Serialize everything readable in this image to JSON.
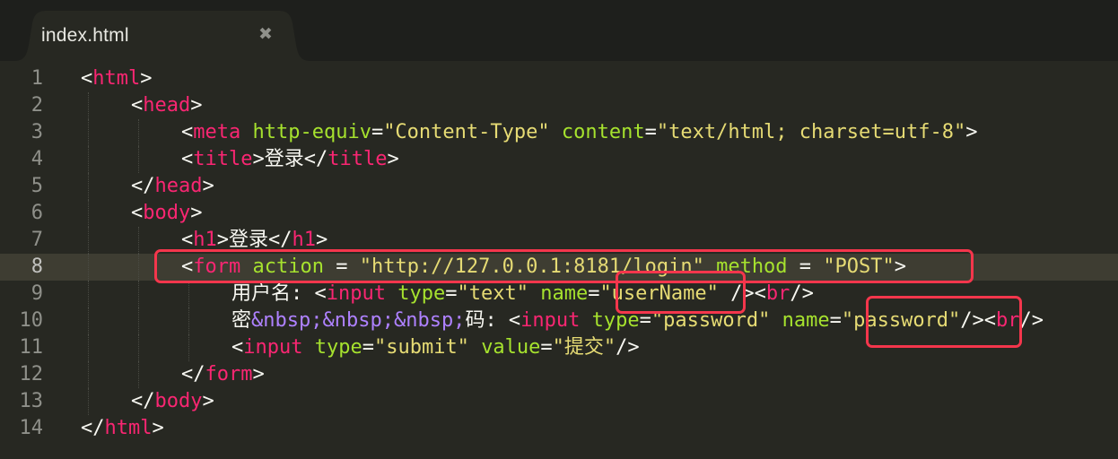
{
  "tab": {
    "title": "index.html",
    "close_glyph": "✖"
  },
  "editor": {
    "current_line": 8,
    "lines": [
      {
        "n": "1",
        "indent": 0,
        "tokens": [
          [
            "p",
            "<"
          ],
          [
            "t",
            "html"
          ],
          [
            "p",
            ">"
          ]
        ]
      },
      {
        "n": "2",
        "indent": 1,
        "tokens": [
          [
            "p",
            "<"
          ],
          [
            "t",
            "head"
          ],
          [
            "p",
            ">"
          ]
        ]
      },
      {
        "n": "3",
        "indent": 2,
        "tokens": [
          [
            "p",
            "<"
          ],
          [
            "t",
            "meta"
          ],
          [
            "p",
            " "
          ],
          [
            "a",
            "http-equiv"
          ],
          [
            "p",
            "="
          ],
          [
            "s",
            "\"Content-Type\""
          ],
          [
            "p",
            " "
          ],
          [
            "a",
            "content"
          ],
          [
            "p",
            "="
          ],
          [
            "s",
            "\"text/html; charset=utf-8\""
          ],
          [
            "p",
            ">"
          ]
        ]
      },
      {
        "n": "4",
        "indent": 2,
        "tokens": [
          [
            "p",
            "<"
          ],
          [
            "t",
            "title"
          ],
          [
            "p",
            ">登录</"
          ],
          [
            "t",
            "title"
          ],
          [
            "p",
            ">"
          ]
        ]
      },
      {
        "n": "5",
        "indent": 1,
        "tokens": [
          [
            "p",
            "</"
          ],
          [
            "t",
            "head"
          ],
          [
            "p",
            ">"
          ]
        ]
      },
      {
        "n": "6",
        "indent": 1,
        "tokens": [
          [
            "p",
            "<"
          ],
          [
            "t",
            "body"
          ],
          [
            "p",
            ">"
          ]
        ]
      },
      {
        "n": "7",
        "indent": 2,
        "tokens": [
          [
            "p",
            "<"
          ],
          [
            "t",
            "h1"
          ],
          [
            "p",
            ">登录</"
          ],
          [
            "t",
            "h1"
          ],
          [
            "p",
            ">"
          ]
        ]
      },
      {
        "n": "8",
        "indent": 2,
        "tokens": [
          [
            "p",
            "<"
          ],
          [
            "t",
            "form"
          ],
          [
            "p",
            " "
          ],
          [
            "a",
            "action"
          ],
          [
            "p",
            " = "
          ],
          [
            "s",
            "\"http://127.0.0.1:8181/login\""
          ],
          [
            "p",
            " "
          ],
          [
            "a",
            "method"
          ],
          [
            "p",
            " = "
          ],
          [
            "s",
            "\"POST\""
          ],
          [
            "p",
            ">"
          ]
        ]
      },
      {
        "n": "9",
        "indent": 3,
        "tokens": [
          [
            "p",
            "用户名: <"
          ],
          [
            "t",
            "input"
          ],
          [
            "p",
            " "
          ],
          [
            "a",
            "type"
          ],
          [
            "p",
            "="
          ],
          [
            "s",
            "\"text\""
          ],
          [
            "p",
            " "
          ],
          [
            "a",
            "name"
          ],
          [
            "p",
            "="
          ],
          [
            "s",
            "\"userName\""
          ],
          [
            "p",
            " /><"
          ],
          [
            "t",
            "br"
          ],
          [
            "p",
            "/>"
          ]
        ]
      },
      {
        "n": "10",
        "indent": 3,
        "tokens": [
          [
            "p",
            "密"
          ],
          [
            "e",
            "&nbsp;&nbsp;&nbsp;"
          ],
          [
            "p",
            "码: <"
          ],
          [
            "t",
            "input"
          ],
          [
            "p",
            " "
          ],
          [
            "a",
            "type"
          ],
          [
            "p",
            "="
          ],
          [
            "s",
            "\"password\""
          ],
          [
            "p",
            " "
          ],
          [
            "a",
            "name"
          ],
          [
            "p",
            "="
          ],
          [
            "s",
            "\"password\""
          ],
          [
            "p",
            "/><"
          ],
          [
            "t",
            "br"
          ],
          [
            "p",
            "/>"
          ]
        ]
      },
      {
        "n": "11",
        "indent": 3,
        "tokens": [
          [
            "p",
            "<"
          ],
          [
            "t",
            "input"
          ],
          [
            "p",
            " "
          ],
          [
            "a",
            "type"
          ],
          [
            "p",
            "="
          ],
          [
            "s",
            "\"submit\""
          ],
          [
            "p",
            " "
          ],
          [
            "a",
            "value"
          ],
          [
            "p",
            "="
          ],
          [
            "s",
            "\"提交\""
          ],
          [
            "p",
            "/>"
          ]
        ]
      },
      {
        "n": "12",
        "indent": 2,
        "tokens": [
          [
            "p",
            "</"
          ],
          [
            "t",
            "form"
          ],
          [
            "p",
            ">"
          ]
        ]
      },
      {
        "n": "13",
        "indent": 1,
        "tokens": [
          [
            "p",
            "</"
          ],
          [
            "t",
            "body"
          ],
          [
            "p",
            ">"
          ]
        ]
      },
      {
        "n": "14",
        "indent": 0,
        "tokens": [
          [
            "p",
            "</"
          ],
          [
            "t",
            "html"
          ],
          [
            "p",
            ">"
          ]
        ]
      }
    ]
  },
  "annotations": {
    "color": "#f4364c",
    "boxes": [
      "form-action-line",
      "username-value",
      "password-value"
    ]
  },
  "colors": {
    "background": "#272822",
    "tag": "#f92672",
    "attribute": "#a6e22e",
    "string": "#e6db74",
    "entity": "#ae81ff",
    "text": "#f8f8f2",
    "line_number": "#8f908a"
  }
}
